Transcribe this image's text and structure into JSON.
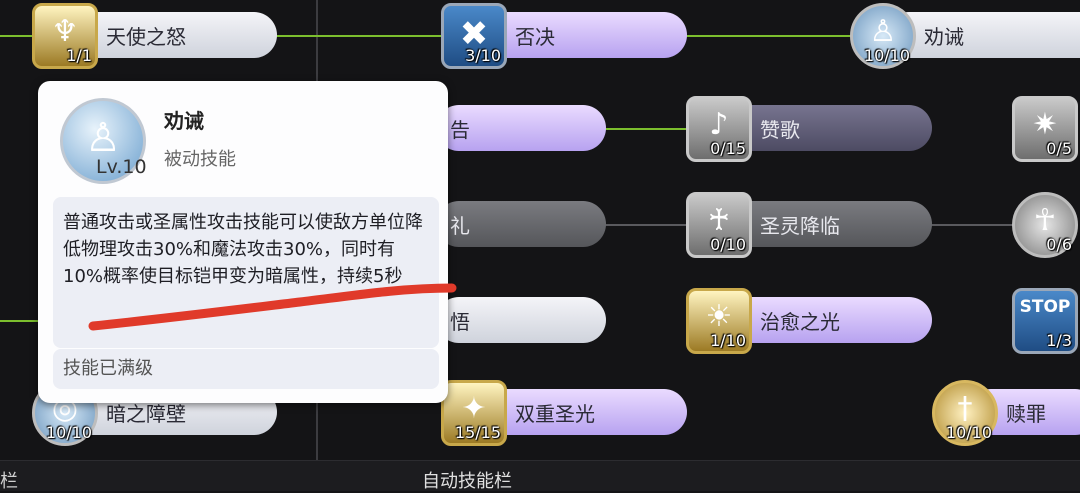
{
  "skills": [
    {
      "key": "angel",
      "name": "天使之怒",
      "level": "1/1",
      "icon_name": "angel-wrath-icon"
    },
    {
      "key": "deny",
      "name": "否决",
      "level": "3/10",
      "icon_name": "veto-x-icon"
    },
    {
      "key": "admonish",
      "name": "劝诫",
      "level": "10/10",
      "icon_name": "admonish-kneel-icon"
    },
    {
      "key": "warn_partial",
      "name": "告",
      "level": "",
      "icon_name": ""
    },
    {
      "key": "hymn",
      "name": "赞歌",
      "level": "0/15",
      "icon_name": "hymn-note-icon"
    },
    {
      "key": "right_a",
      "name": "",
      "level": "0/5",
      "icon_name": "holy-burst-icon"
    },
    {
      "key": "rite_partial",
      "name": "礼",
      "level": "",
      "icon_name": ""
    },
    {
      "key": "holy_spirit",
      "name": "圣灵降临",
      "level": "0/10",
      "icon_name": "winged-spirit-icon"
    },
    {
      "key": "right_b",
      "name": "",
      "level": "0/6",
      "icon_name": "halo-figure-icon"
    },
    {
      "key": "enlighten_partial",
      "name": "悟",
      "level": "",
      "icon_name": ""
    },
    {
      "key": "heal_light",
      "name": "治愈之光",
      "level": "1/10",
      "icon_name": "healing-light-icon"
    },
    {
      "key": "stop",
      "name": "",
      "level": "1/3",
      "icon_name": "stop-sign-icon"
    },
    {
      "key": "dark_barrier",
      "name": "暗之障壁",
      "level": "10/10",
      "icon_name": "dark-barrier-icon"
    },
    {
      "key": "double_holy",
      "name": "双重圣光",
      "level": "15/15",
      "icon_name": "double-sparkle-icon"
    },
    {
      "key": "atone",
      "name": "赎罪",
      "level": "10/10",
      "icon_name": "atonement-sword-icon"
    }
  ],
  "stop_text": "STOP",
  "tooltip": {
    "name": "劝诫",
    "type": "被动技能",
    "level": "Lv.10",
    "description": "普通攻击或圣属性攻击技能可以使敌方单位降低物理攻击30%和魔法攻击30%，同时有10%概率使目标铠甲变为暗属性，持续5秒",
    "status": "技能已满级",
    "annotation_color": "#e03a2a"
  },
  "bottom_bar": {
    "left_label": "栏",
    "center_label": "自动技能栏"
  },
  "colors": {
    "background": "#141416",
    "link_green": "#7cbf2e",
    "pill_purple": "#c7b3f5",
    "pill_white": "#e4e6ee"
  }
}
